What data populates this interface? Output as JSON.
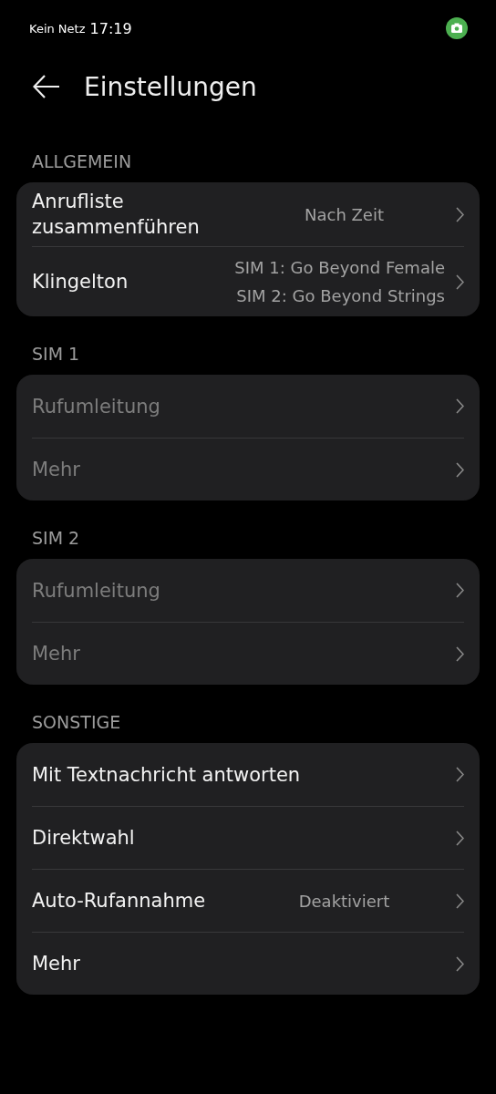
{
  "status_bar": {
    "carrier": "Kein Netz",
    "time": "17:19"
  },
  "header": {
    "title": "Einstellungen"
  },
  "sections": [
    {
      "title": "ALLGEMEIN",
      "items": [
        {
          "label": "Anrufliste zusammenführen",
          "value": [
            "Nach Zeit"
          ],
          "disabled": false
        },
        {
          "label": "Klingelton",
          "value": [
            "SIM 1: Go Beyond Female",
            "SIM 2: Go Beyond Strings"
          ],
          "disabled": false
        }
      ]
    },
    {
      "title": "SIM 1",
      "items": [
        {
          "label": "Rufumleitung",
          "disabled": true
        },
        {
          "label": "Mehr",
          "disabled": true
        }
      ]
    },
    {
      "title": "SIM 2",
      "items": [
        {
          "label": "Rufumleitung",
          "disabled": true
        },
        {
          "label": "Mehr",
          "disabled": true
        }
      ]
    },
    {
      "title": "SONSTIGE",
      "items": [
        {
          "label": "Mit Textnachricht antworten",
          "disabled": false
        },
        {
          "label": "Direktwahl",
          "disabled": false
        },
        {
          "label": "Auto-Rufannahme",
          "value": [
            "Deaktiviert"
          ],
          "disabled": false
        },
        {
          "label": "Mehr",
          "disabled": false
        }
      ]
    }
  ]
}
